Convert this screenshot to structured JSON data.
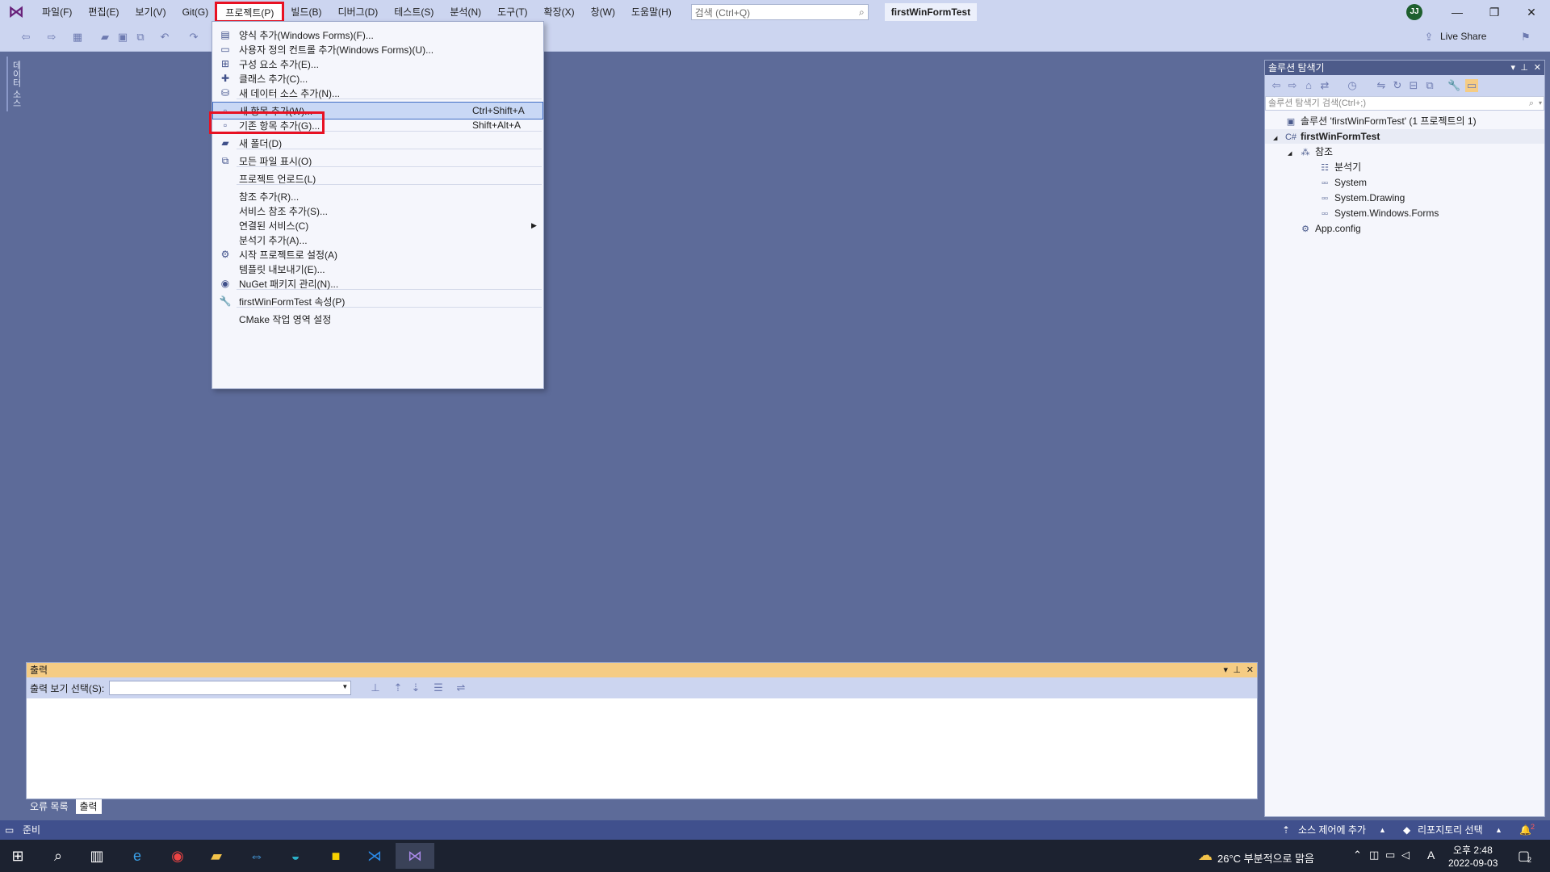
{
  "menubar": {
    "items": [
      "파일(F)",
      "편집(E)",
      "보기(V)",
      "Git(G)",
      "프로젝트(P)",
      "빌드(B)",
      "디버그(D)",
      "테스트(S)",
      "분석(N)",
      "도구(T)",
      "확장(X)",
      "창(W)",
      "도움말(H)"
    ],
    "active_index": 4,
    "search_placeholder": "검색 (Ctrl+Q)",
    "project_title": "firstWinFormTest",
    "account_initials": "JJ"
  },
  "window_controls": {
    "minimize": "—",
    "restore": "❐",
    "close": "✕"
  },
  "toolbar": {
    "live_share": "Live Share"
  },
  "side_tab": "데이터 소스",
  "project_menu": {
    "items": [
      {
        "label": "양식 추가(Windows Forms)(F)...",
        "icon": "form-icon",
        "glyph": "▤",
        "shortcut": ""
      },
      {
        "label": "사용자 정의 컨트롤 추가(Windows Forms)(U)...",
        "icon": "user-control-icon",
        "glyph": "▭",
        "shortcut": ""
      },
      {
        "label": "구성 요소 추가(E)...",
        "icon": "component-icon",
        "glyph": "⊞",
        "shortcut": ""
      },
      {
        "label": "클래스 추가(C)...",
        "icon": "class-icon",
        "glyph": "✚",
        "shortcut": ""
      },
      {
        "label": "새 데이터 소스 추가(N)...",
        "icon": "data-source-icon",
        "glyph": "⛁",
        "shortcut": ""
      },
      {
        "label": "새 항목 추가(W)...",
        "icon": "new-item-icon",
        "glyph": "▫",
        "shortcut": "Ctrl+Shift+A"
      },
      {
        "label": "기존 항목 추가(G)...",
        "icon": "existing-item-icon",
        "glyph": "▫",
        "shortcut": "Shift+Alt+A"
      },
      {
        "label": "새 폴더(D)",
        "icon": "folder-icon",
        "glyph": "▰",
        "shortcut": ""
      },
      {
        "label": "모든 파일 표시(O)",
        "icon": "show-all-files-icon",
        "glyph": "⧉",
        "shortcut": ""
      },
      {
        "label": "프로젝트 언로드(L)",
        "icon": "",
        "glyph": "",
        "shortcut": ""
      },
      {
        "label": "참조 추가(R)...",
        "icon": "",
        "glyph": "",
        "shortcut": ""
      },
      {
        "label": "서비스 참조 추가(S)...",
        "icon": "",
        "glyph": "",
        "shortcut": ""
      },
      {
        "label": "연결된 서비스(C)",
        "icon": "",
        "glyph": "",
        "shortcut": "",
        "submenu": true
      },
      {
        "label": "분석기 추가(A)...",
        "icon": "",
        "glyph": "",
        "shortcut": ""
      },
      {
        "label": "시작 프로젝트로 설정(A)",
        "icon": "gear-icon",
        "glyph": "⚙",
        "shortcut": ""
      },
      {
        "label": "템플릿 내보내기(E)...",
        "icon": "",
        "glyph": "",
        "shortcut": ""
      },
      {
        "label": "NuGet 패키지 관리(N)...",
        "icon": "nuget-icon",
        "glyph": "◉",
        "shortcut": ""
      },
      {
        "label": "firstWinFormTest 속성(P)",
        "icon": "wrench-icon",
        "glyph": "🔧",
        "shortcut": ""
      },
      {
        "label": "CMake 작업 영역 설정",
        "icon": "",
        "glyph": "",
        "shortcut": ""
      }
    ],
    "highlighted_index": 5
  },
  "solution_explorer": {
    "title": "솔루션 탐색기",
    "search_placeholder": "솔루션 탐색기 검색(Ctrl+;)",
    "tree": [
      {
        "label": "솔루션 'firstWinFormTest' (1 프로젝트의 1)",
        "icon": "solution-icon",
        "glyph": "▣",
        "level": 0,
        "expand": ""
      },
      {
        "label": "firstWinFormTest",
        "icon": "csharp-project-icon",
        "glyph": "C#",
        "level": 0,
        "expand": "◢",
        "bold": true
      },
      {
        "label": "참조",
        "icon": "references-icon",
        "glyph": "⁂",
        "level": 1,
        "expand": "◢"
      },
      {
        "label": "분석기",
        "icon": "analyzer-icon",
        "glyph": "☷",
        "level": 2,
        "expand": ""
      },
      {
        "label": "System",
        "icon": "assembly-icon",
        "glyph": "▫▫",
        "level": 2,
        "expand": ""
      },
      {
        "label": "System.Drawing",
        "icon": "assembly-icon",
        "glyph": "▫▫",
        "level": 2,
        "expand": ""
      },
      {
        "label": "System.Windows.Forms",
        "icon": "assembly-icon",
        "glyph": "▫▫",
        "level": 2,
        "expand": ""
      },
      {
        "label": "App.config",
        "icon": "config-file-icon",
        "glyph": "⚙",
        "level": 1,
        "expand": ""
      }
    ]
  },
  "output_panel": {
    "title": "출력",
    "source_label": "출력 보기 선택(S):",
    "source_value": "",
    "tabs": [
      "오류 목록",
      "출력"
    ],
    "active_tab": 1
  },
  "statusbar": {
    "ready": "준비",
    "source_control": "소스 제어에 추가",
    "repository": "리포지토리 선택",
    "notifications": "2"
  },
  "taskbar": {
    "weather": "26°C 부분적으로 맑음",
    "time": "오후 2:48",
    "date": "2022-09-03",
    "ime": "A",
    "notif_count": "2"
  }
}
